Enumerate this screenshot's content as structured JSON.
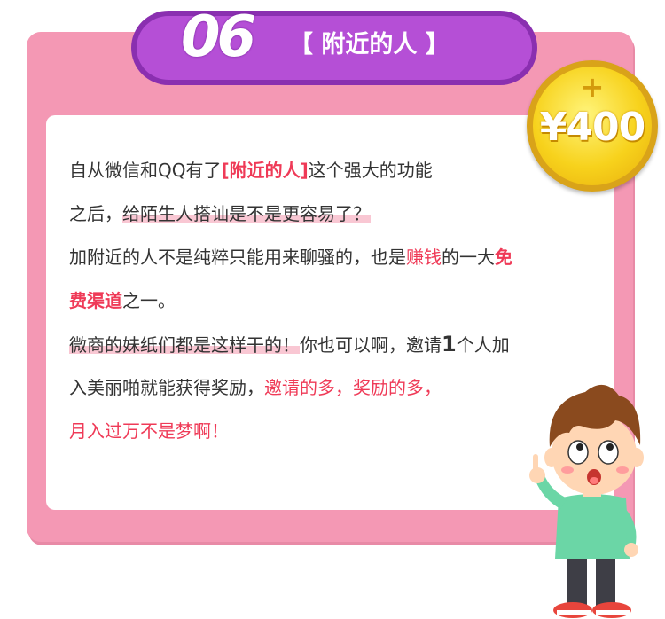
{
  "banner": {
    "number": "06",
    "title": "【 附近的人 】"
  },
  "reward": {
    "plus": "+",
    "amount": "¥400"
  },
  "content": {
    "line1_a": "自从微信和QQ有了",
    "line1_b": "[附近的人]",
    "line1_c": "这个强大的功能",
    "line2_a": "之后，",
    "line2_b": "给陌生人搭讪是不是更容易了？",
    "line3_a": "加附近的人不是纯粹只能用来聊骚的，也是",
    "line3_b": "赚钱",
    "line3_c": "的一大",
    "line3_d": "免",
    "line4_a": "费渠道",
    "line4_b": "之一。",
    "line5_a": "微商的妹纸们都是这样干的！",
    "line5_b": "你也可以啊，邀请",
    "line5_c": "1",
    "line5_d": "个人加",
    "line6_a": "入美丽啪就能获得奖励，",
    "line6_b": "邀请的多，奖励的多，",
    "line7": "月入过万不是梦啊！"
  },
  "colors": {
    "card": "#f498b4",
    "banner": "#b54fd6",
    "accent_red": "#ef3a57",
    "coin": "#f7d21c"
  }
}
